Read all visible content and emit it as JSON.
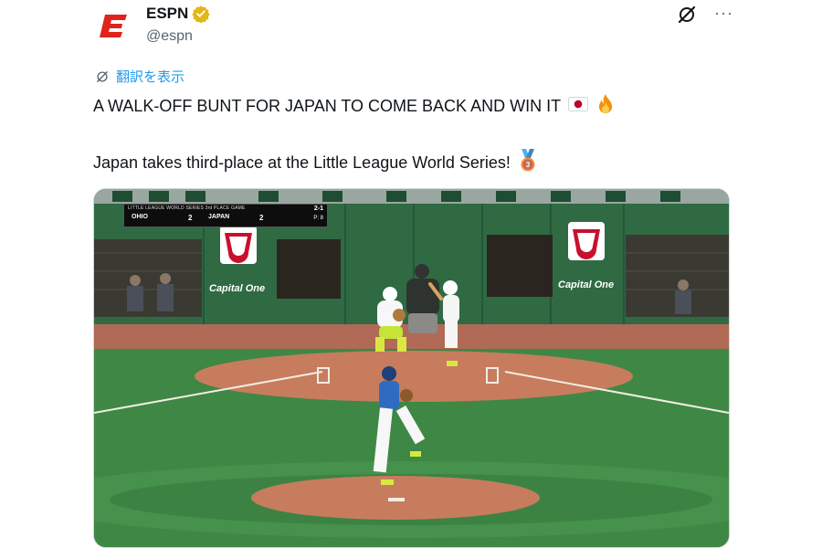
{
  "account": {
    "display_name": "ESPN",
    "handle": "@espn",
    "brand_color": "#e0231b",
    "verified_color": "#e2b719"
  },
  "actions": {
    "grok_icon": "grok-icon",
    "more_label": "···"
  },
  "translate": {
    "label": "翻訳を表示",
    "color": "#1d9bf0"
  },
  "tweet": {
    "line1": "A WALK-OFF BUNT FOR JAPAN TO COME BACK AND WIN IT",
    "line1_emojis": [
      "🇯🇵",
      "🔥"
    ],
    "line2": "Japan takes third-place at the Little League World Series!",
    "line2_emoji": "🥉"
  },
  "media": {
    "scorebug": {
      "title": "LITTLE LEAGUE WORLD SERIES 3rd PLACE GAME",
      "away_team": "OHIO",
      "away_score": "2",
      "home_team": "JAPAN",
      "home_score": "2",
      "count": "2-1",
      "pitch": "P: 8"
    },
    "sponsor_left": "Capital One",
    "sponsor_right": "Capital One"
  }
}
